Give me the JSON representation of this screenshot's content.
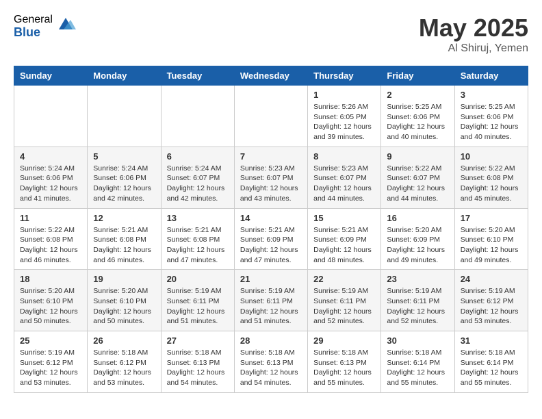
{
  "header": {
    "logo_general": "General",
    "logo_blue": "Blue",
    "title": "May 2025",
    "location": "Al Shiruj, Yemen"
  },
  "weekdays": [
    "Sunday",
    "Monday",
    "Tuesday",
    "Wednesday",
    "Thursday",
    "Friday",
    "Saturday"
  ],
  "weeks": [
    [
      {
        "day": "",
        "info": ""
      },
      {
        "day": "",
        "info": ""
      },
      {
        "day": "",
        "info": ""
      },
      {
        "day": "",
        "info": ""
      },
      {
        "day": "1",
        "info": "Sunrise: 5:26 AM\nSunset: 6:05 PM\nDaylight: 12 hours\nand 39 minutes."
      },
      {
        "day": "2",
        "info": "Sunrise: 5:25 AM\nSunset: 6:06 PM\nDaylight: 12 hours\nand 40 minutes."
      },
      {
        "day": "3",
        "info": "Sunrise: 5:25 AM\nSunset: 6:06 PM\nDaylight: 12 hours\nand 40 minutes."
      }
    ],
    [
      {
        "day": "4",
        "info": "Sunrise: 5:24 AM\nSunset: 6:06 PM\nDaylight: 12 hours\nand 41 minutes."
      },
      {
        "day": "5",
        "info": "Sunrise: 5:24 AM\nSunset: 6:06 PM\nDaylight: 12 hours\nand 42 minutes."
      },
      {
        "day": "6",
        "info": "Sunrise: 5:24 AM\nSunset: 6:07 PM\nDaylight: 12 hours\nand 42 minutes."
      },
      {
        "day": "7",
        "info": "Sunrise: 5:23 AM\nSunset: 6:07 PM\nDaylight: 12 hours\nand 43 minutes."
      },
      {
        "day": "8",
        "info": "Sunrise: 5:23 AM\nSunset: 6:07 PM\nDaylight: 12 hours\nand 44 minutes."
      },
      {
        "day": "9",
        "info": "Sunrise: 5:22 AM\nSunset: 6:07 PM\nDaylight: 12 hours\nand 44 minutes."
      },
      {
        "day": "10",
        "info": "Sunrise: 5:22 AM\nSunset: 6:08 PM\nDaylight: 12 hours\nand 45 minutes."
      }
    ],
    [
      {
        "day": "11",
        "info": "Sunrise: 5:22 AM\nSunset: 6:08 PM\nDaylight: 12 hours\nand 46 minutes."
      },
      {
        "day": "12",
        "info": "Sunrise: 5:21 AM\nSunset: 6:08 PM\nDaylight: 12 hours\nand 46 minutes."
      },
      {
        "day": "13",
        "info": "Sunrise: 5:21 AM\nSunset: 6:08 PM\nDaylight: 12 hours\nand 47 minutes."
      },
      {
        "day": "14",
        "info": "Sunrise: 5:21 AM\nSunset: 6:09 PM\nDaylight: 12 hours\nand 47 minutes."
      },
      {
        "day": "15",
        "info": "Sunrise: 5:21 AM\nSunset: 6:09 PM\nDaylight: 12 hours\nand 48 minutes."
      },
      {
        "day": "16",
        "info": "Sunrise: 5:20 AM\nSunset: 6:09 PM\nDaylight: 12 hours\nand 49 minutes."
      },
      {
        "day": "17",
        "info": "Sunrise: 5:20 AM\nSunset: 6:10 PM\nDaylight: 12 hours\nand 49 minutes."
      }
    ],
    [
      {
        "day": "18",
        "info": "Sunrise: 5:20 AM\nSunset: 6:10 PM\nDaylight: 12 hours\nand 50 minutes."
      },
      {
        "day": "19",
        "info": "Sunrise: 5:20 AM\nSunset: 6:10 PM\nDaylight: 12 hours\nand 50 minutes."
      },
      {
        "day": "20",
        "info": "Sunrise: 5:19 AM\nSunset: 6:11 PM\nDaylight: 12 hours\nand 51 minutes."
      },
      {
        "day": "21",
        "info": "Sunrise: 5:19 AM\nSunset: 6:11 PM\nDaylight: 12 hours\nand 51 minutes."
      },
      {
        "day": "22",
        "info": "Sunrise: 5:19 AM\nSunset: 6:11 PM\nDaylight: 12 hours\nand 52 minutes."
      },
      {
        "day": "23",
        "info": "Sunrise: 5:19 AM\nSunset: 6:11 PM\nDaylight: 12 hours\nand 52 minutes."
      },
      {
        "day": "24",
        "info": "Sunrise: 5:19 AM\nSunset: 6:12 PM\nDaylight: 12 hours\nand 53 minutes."
      }
    ],
    [
      {
        "day": "25",
        "info": "Sunrise: 5:19 AM\nSunset: 6:12 PM\nDaylight: 12 hours\nand 53 minutes."
      },
      {
        "day": "26",
        "info": "Sunrise: 5:18 AM\nSunset: 6:12 PM\nDaylight: 12 hours\nand 53 minutes."
      },
      {
        "day": "27",
        "info": "Sunrise: 5:18 AM\nSunset: 6:13 PM\nDaylight: 12 hours\nand 54 minutes."
      },
      {
        "day": "28",
        "info": "Sunrise: 5:18 AM\nSunset: 6:13 PM\nDaylight: 12 hours\nand 54 minutes."
      },
      {
        "day": "29",
        "info": "Sunrise: 5:18 AM\nSunset: 6:13 PM\nDaylight: 12 hours\nand 55 minutes."
      },
      {
        "day": "30",
        "info": "Sunrise: 5:18 AM\nSunset: 6:14 PM\nDaylight: 12 hours\nand 55 minutes."
      },
      {
        "day": "31",
        "info": "Sunrise: 5:18 AM\nSunset: 6:14 PM\nDaylight: 12 hours\nand 55 minutes."
      }
    ]
  ]
}
